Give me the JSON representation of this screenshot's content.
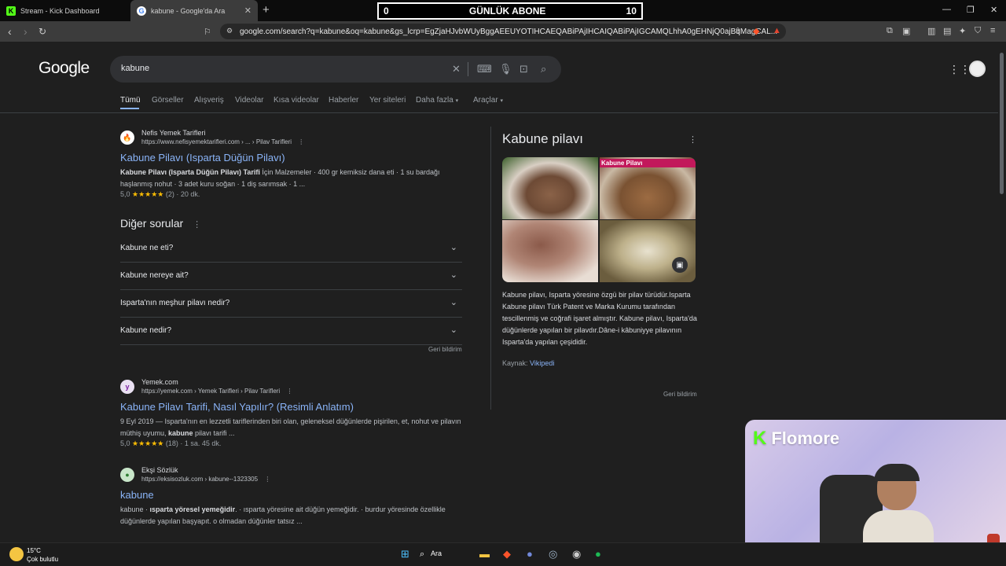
{
  "browser": {
    "tabs": [
      {
        "label": "Stream - Kick Dashboard",
        "icon": "kick-icon"
      },
      {
        "label": "kabune - Google'da Ara",
        "icon": "google-icon"
      }
    ],
    "url": "google.com/search?q=kabune&oq=kabune&gs_lcrp=EgZjaHJvbWUyBggAEEUYOTIHCAEQABiPAjIHCAIQABiPAjIGCAMQLhhA0gEHNjQ0ajBqMagCAL..."
  },
  "overlay": {
    "counter_left": "0",
    "counter_title": "GÜNLÜK ABONE",
    "counter_right": "10",
    "streamer_name": "Flomore"
  },
  "google": {
    "logo": "Google",
    "query": "kabune",
    "tabs": [
      "Tümü",
      "Görseller",
      "Alışveriş",
      "Videolar",
      "Kısa videolar",
      "Haberler",
      "Yer siteleri",
      "Daha fazla",
      "Araçlar"
    ],
    "results": [
      {
        "site": "Nefis Yemek Tarifleri",
        "url": "https://www.nefisyemektarifleri.com › ... › Pilav Tarifleri",
        "title": "Kabune Pilavı (Isparta Düğün Pilavı)",
        "snippet_bold": "Kabune Pilavı (Isparta Düğün Pilavı) Tarifi",
        "snippet": " İçin Malzemeler · 400 gr kemiksiz dana eti · 1 su bardağı haşlanmış nohut · 3 adet kuru soğan · 1 diş sarımsak · 1 ...",
        "rating": "5,0",
        "stars": "★★★★★",
        "meta": "(2) · 20 dk."
      },
      {
        "site": "Yemek.com",
        "url": "https://yemek.com › Yemek Tarifleri › Pilav Tarifleri",
        "title": "Kabune Pilavı Tarifi, Nasıl Yapılır? (Resimli Anlatım)",
        "snippet_pre": "9 Eyl 2019 — Isparta'nın en lezzetli tariflerinden biri olan, geleneksel düğünlerde pişirilen, et, nohut ve pilavın müthiş uyumu, ",
        "snippet_bold": "kabune",
        "snippet_post": " pilavı tarifi ...",
        "rating": "5,0",
        "stars": "★★★★★",
        "meta": "(18) · 1 sa. 45 dk."
      },
      {
        "site": "Ekşi Sözlük",
        "url": "https://eksisozluk.com › kabune--1323305",
        "title": "kabune",
        "snippet_pre": "kabune · ",
        "snippet_bold": "ısparta yöresel yemeğidir",
        "snippet_post": ". · ısparta yöresine ait düğün yemeğidir. · burdur yöresinde özellikle düğünlerde yapılan başyapıt. o olmadan düğünler tatsız ..."
      }
    ],
    "paa": {
      "title": "Diğer sorular",
      "questions": [
        "Kabune ne eti?",
        "Kabune nereye ait?",
        "Isparta'nın meşhur pilavı nedir?",
        "Kabune nedir?"
      ],
      "feedback": "Geri bildirim"
    },
    "knowledge_panel": {
      "title": "Kabune pilavı",
      "image_caption": "Kabune Pilavı",
      "description": "Kabune pilavı, Isparta yöresine özgü bir pilav türüdür.Isparta Kabune pilavı Türk Patent ve Marka Kurumu tarafından tescillenmiş ve coğrafi işaret almıştır. Kabune pilavı, Isparta'da düğünlerde yapılan bir pilavdır.Dâne-i kâbuniyye pilavının Isparta'da yapılan çeşididir.",
      "source_label": "Kaynak:",
      "source_link": "Vikipedi",
      "feedback": "Geri bildirim"
    }
  },
  "taskbar": {
    "temp": "15°C",
    "weather": "Çok bulutlu",
    "search": "Ara"
  }
}
